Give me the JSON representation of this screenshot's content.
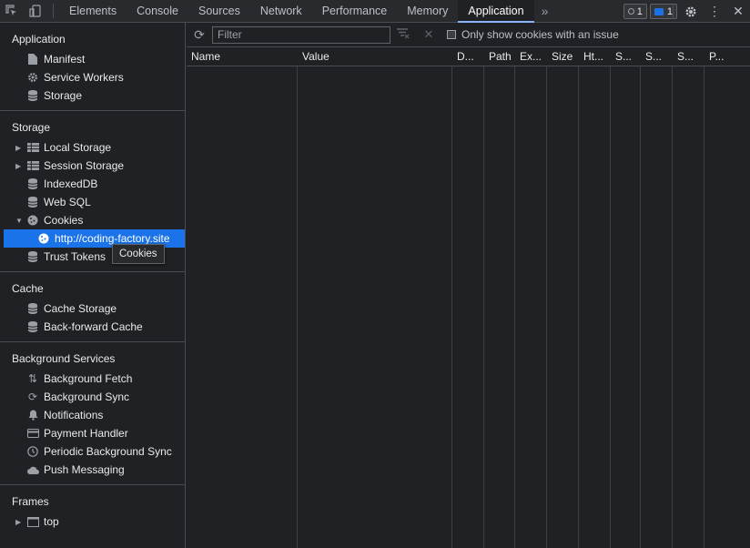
{
  "toolbar": {
    "tabs": [
      "Elements",
      "Console",
      "Sources",
      "Network",
      "Performance",
      "Memory",
      "Application"
    ],
    "active_tab": "Application",
    "more": "»",
    "issues_count": "1",
    "messages_count": "1",
    "accent": "#8ab4f8"
  },
  "sidebar": {
    "application": {
      "title": "Application",
      "items": [
        "Manifest",
        "Service Workers",
        "Storage"
      ]
    },
    "storage": {
      "title": "Storage",
      "items": [
        "Local Storage",
        "Session Storage",
        "IndexedDB",
        "Web SQL",
        "Cookies",
        "http://coding-factory.site",
        "Trust Tokens"
      ]
    },
    "cache": {
      "title": "Cache",
      "items": [
        "Cache Storage",
        "Back-forward Cache"
      ]
    },
    "background": {
      "title": "Background Services",
      "items": [
        "Background Fetch",
        "Background Sync",
        "Notifications",
        "Payment Handler",
        "Periodic Background Sync",
        "Push Messaging"
      ]
    },
    "frames": {
      "title": "Frames",
      "items": [
        "top"
      ]
    },
    "selected_color": "#1a73e8"
  },
  "tooltip": "Cookies",
  "filterbar": {
    "placeholder": "Filter",
    "checkbox_label": "Only show cookies with an issue"
  },
  "table": {
    "columns": [
      "Name",
      "Value",
      "D...",
      "Path",
      "Ex...",
      "Size",
      "Ht...",
      "S...",
      "S...",
      "S...",
      "P..."
    ]
  }
}
